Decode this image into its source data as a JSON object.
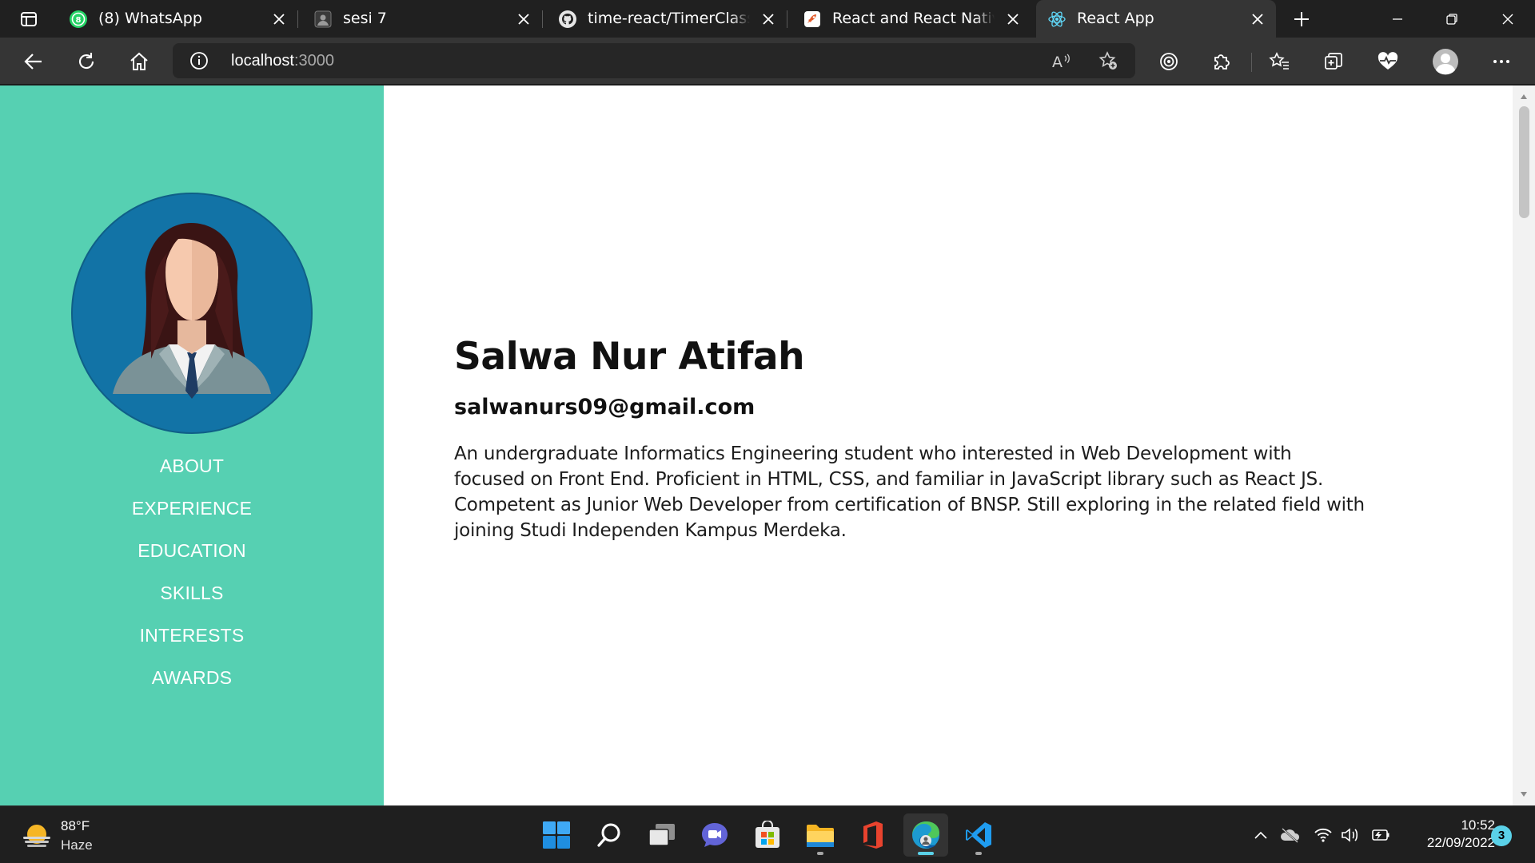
{
  "browser": {
    "tabs": [
      {
        "title": "(8) WhatsApp",
        "favicon": "whatsapp-icon",
        "badge": "8"
      },
      {
        "title": "sesi 7",
        "favicon": "profile-icon"
      },
      {
        "title": "time-react/TimerClass.js at",
        "favicon": "github-icon"
      },
      {
        "title": "React and React Native Ba",
        "favicon": "rocket-icon"
      },
      {
        "title": "React App",
        "favicon": "react-icon",
        "active": true
      }
    ],
    "address": {
      "host": "localhost",
      "port": ":3000"
    }
  },
  "sidebar": {
    "background": "#56d0b2",
    "avatar_bg": "#1273a6",
    "nav": [
      "ABOUT",
      "EXPERIENCE",
      "EDUCATION",
      "SKILLS",
      "INTERESTS",
      "AWARDS"
    ]
  },
  "profile": {
    "name": "Salwa Nur Atifah",
    "email": "salwanurs09@gmail.com",
    "bio": "An undergraduate Informatics Engineering student who interested in Web Development with focused on Front End. Proficient in HTML, CSS, and familiar in JavaScript library such as React JS. Competent as Junior Web Developer from certification of BNSP. Still exploring in the related field with joining Studi Independen Kampus Merdeka."
  },
  "taskbar": {
    "weather": {
      "temp": "88°F",
      "condition": "Haze"
    },
    "apps": [
      "start-icon",
      "search-icon",
      "task-view-icon",
      "teams-chat-icon",
      "store-icon",
      "file-explorer-icon",
      "office-icon",
      "edge-icon",
      "vscode-icon"
    ],
    "time": "10:52",
    "date": "22/09/2022",
    "notifications": "3"
  }
}
